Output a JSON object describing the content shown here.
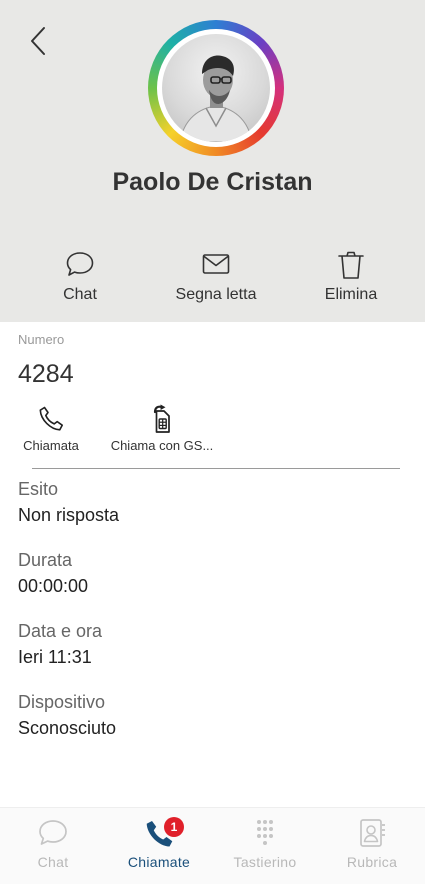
{
  "contact": {
    "name": "Paolo De Cristan"
  },
  "actions": {
    "chat": "Chat",
    "mark_read": "Segna letta",
    "delete": "Elimina"
  },
  "number_section": {
    "label": "Numero",
    "value": "4284"
  },
  "call_options": {
    "call": "Chiamata",
    "call_gsm": "Chiama con GS..."
  },
  "details": [
    {
      "label": "Esito",
      "value": "Non risposta"
    },
    {
      "label": "Durata",
      "value": "00:00:00"
    },
    {
      "label": "Data e ora",
      "value": "Ieri 11:31"
    },
    {
      "label": "Dispositivo",
      "value": "Sconosciuto"
    }
  ],
  "bottom_nav": {
    "items": [
      {
        "label": "Chat",
        "icon": "chat-icon"
      },
      {
        "label": "Chiamate",
        "icon": "phone-icon",
        "badge": "1"
      },
      {
        "label": "Tastierino",
        "icon": "dialpad-icon"
      },
      {
        "label": "Rubrica",
        "icon": "contacts-icon"
      }
    ],
    "active": "Chiamate"
  },
  "colors": {
    "header_bg": "#e8e8e6",
    "accent": "#1a4f7a",
    "badge": "#e0202a"
  }
}
